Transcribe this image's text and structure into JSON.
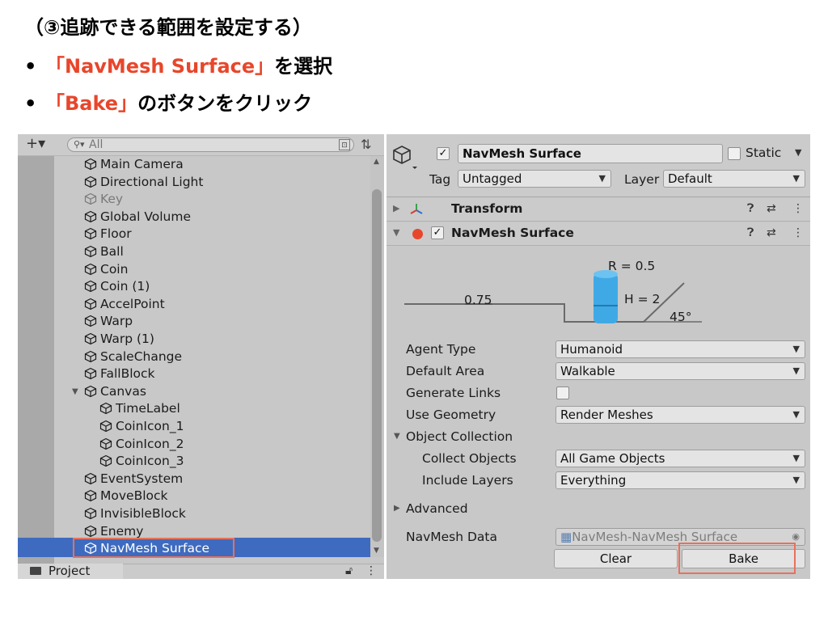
{
  "slide": {
    "title": "（③追跡できる範囲を設定する）",
    "bullets": [
      {
        "dot": "•",
        "highlight": "「NavMesh Surface」",
        "rest": "を選択"
      },
      {
        "dot": "•",
        "highlight": "「Bake」",
        "rest": "のボタンをクリック"
      }
    ],
    "accent_color": "#e8462b",
    "callout_border_color": "#e8715a"
  },
  "hierarchy": {
    "add_glyph": "+▾",
    "search_placeholder": "All",
    "items": [
      {
        "label": "Main Camera",
        "indent": 0
      },
      {
        "label": "Directional Light",
        "indent": 0
      },
      {
        "label": "Key",
        "indent": 0,
        "disabled": true
      },
      {
        "label": "Global Volume",
        "indent": 0
      },
      {
        "label": "Floor",
        "indent": 0
      },
      {
        "label": "Ball",
        "indent": 0
      },
      {
        "label": "Coin",
        "indent": 0
      },
      {
        "label": "Coin (1)",
        "indent": 0
      },
      {
        "label": "AccelPoint",
        "indent": 0
      },
      {
        "label": "Warp",
        "indent": 0
      },
      {
        "label": "Warp (1)",
        "indent": 0
      },
      {
        "label": "ScaleChange",
        "indent": 0
      },
      {
        "label": "FallBlock",
        "indent": 0
      },
      {
        "label": "Canvas",
        "indent": 0,
        "expanded": true
      },
      {
        "label": "TimeLabel",
        "indent": 1
      },
      {
        "label": "CoinIcon_1",
        "indent": 1
      },
      {
        "label": "CoinIcon_2",
        "indent": 1
      },
      {
        "label": "CoinIcon_3",
        "indent": 1
      },
      {
        "label": "EventSystem",
        "indent": 0
      },
      {
        "label": "MoveBlock",
        "indent": 0
      },
      {
        "label": "InvisibleBlock",
        "indent": 0
      },
      {
        "label": "Enemy",
        "indent": 0
      },
      {
        "label": "NavMesh Surface",
        "indent": 0,
        "selected": true
      }
    ],
    "selection_color": "#3e6bbf",
    "project_tab": "Project"
  },
  "inspector": {
    "object_name": "NavMesh Surface",
    "static_label": "Static",
    "tag_label": "Tag",
    "tag_value": "Untagged",
    "layer_label": "Layer",
    "layer_value": "Default",
    "transform_label": "Transform",
    "component_label": "NavMesh Surface",
    "diagram": {
      "radius": "R = 0.5",
      "step": "0.75",
      "height": "H = 2",
      "slope": "45°"
    },
    "fields": {
      "agent_type_label": "Agent Type",
      "agent_type_value": "Humanoid",
      "default_area_label": "Default Area",
      "default_area_value": "Walkable",
      "generate_links_label": "Generate Links",
      "use_geometry_label": "Use Geometry",
      "use_geometry_value": "Render Meshes",
      "object_collection_label": "Object Collection",
      "collect_objects_label": "Collect Objects",
      "collect_objects_value": "All Game Objects",
      "include_layers_label": "Include Layers",
      "include_layers_value": "Everything",
      "advanced_label": "Advanced",
      "navmesh_data_label": "NavMesh Data",
      "navmesh_data_value": "NavMesh-NavMesh Surface"
    },
    "clear_button": "Clear",
    "bake_button": "Bake"
  }
}
